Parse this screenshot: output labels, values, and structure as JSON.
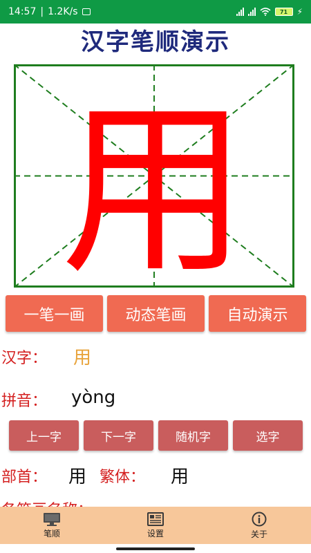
{
  "status_bar": {
    "time": "14:57",
    "net_speed": "1.2K/s",
    "battery_level": "71"
  },
  "app_title": "汉字笔顺演示",
  "character": {
    "glyph": "用",
    "glyph_color": "#ff0000",
    "grid_color": "#1e7d1e"
  },
  "mode_buttons": [
    "一笔一画",
    "动态笔画",
    "自动演示"
  ],
  "info": {
    "hanzi_label": "汉字：",
    "hanzi_value": "用",
    "pinyin_label": "拼音：",
    "pinyin_value": "yòng",
    "radical_label": "部首：",
    "radical_value": "用",
    "traditional_label": "繁体：",
    "traditional_value": "用",
    "stroke_names_label": "各笔画名称："
  },
  "nav_buttons": [
    "上一字",
    "下一字",
    "随机字",
    "选字"
  ],
  "bottom_tabs": [
    {
      "label": "笔顺",
      "icon": "monitor-icon"
    },
    {
      "label": "设置",
      "icon": "document-icon"
    },
    {
      "label": "关于",
      "icon": "info-icon"
    }
  ],
  "colors": {
    "title": "#1f2a7c",
    "mode_button": "#f06a52",
    "nav_button": "#c95d5d",
    "label": "#d41f1f",
    "hanzi_value": "#e8a33a",
    "bottom_nav": "#f7c79a"
  }
}
